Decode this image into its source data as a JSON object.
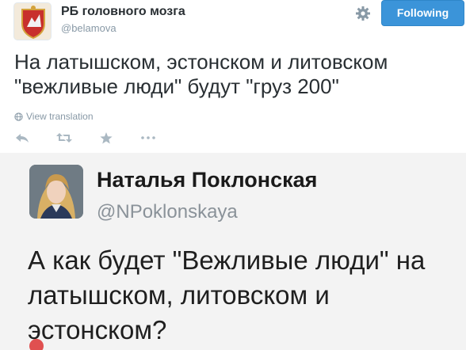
{
  "header": {
    "name": "РБ головного мозга",
    "handle": "@belamova",
    "follow_label": "Following"
  },
  "tweet": {
    "text": "На латышском, эстонском и литовском \"вежливые люди\" будут \"груз 200\"",
    "translate_label": "View translation"
  },
  "actions": [
    "reply-icon",
    "retweet-icon",
    "favorite-icon",
    "more-icon"
  ],
  "embedded": {
    "name": "Наталья Поклонская",
    "handle": "@NPoklonskaya",
    "text": "А как будет \"Вежливые люди\" на латышском, литовском и эстонском?"
  },
  "colors": {
    "follow_button": "#3b94d9",
    "secondary_text": "#8899a6",
    "primary_text": "#292f33"
  }
}
